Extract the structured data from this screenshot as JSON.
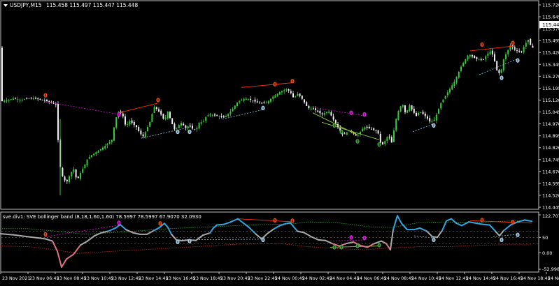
{
  "main_panel": {
    "symbol_label": "USDJPY,M15",
    "ohlc_label": "115.458 115.497 115.447 115.448",
    "current_price_label": "115.448",
    "price_ticks": [
      "115.720",
      "115.645",
      "115.570",
      "115.495",
      "115.420",
      "115.345",
      "115.270",
      "115.195",
      "115.120",
      "115.045",
      "114.970",
      "114.895",
      "114.820",
      "114.745",
      "114.670",
      "114.595",
      "114.520",
      "114.445"
    ],
    "ylim": [
      114.445,
      115.72
    ]
  },
  "sub_panel": {
    "indicator_label": "sve.div1: SVE bollinger band (8,18,1.60,1.60) 78.5997 78.5997 67.9070 32.0930",
    "level_ticks": [
      "122.7079",
      "50",
      "0.00",
      "-52.9981"
    ],
    "ylim": [
      -52.9981,
      122.7079
    ]
  },
  "time_axis": {
    "labels": [
      "23 Nov 2021",
      "23 Nov 06:45",
      "23 Nov 08:45",
      "23 Nov 10:45",
      "23 Nov 12:45",
      "23 Nov 14:45",
      "23 Nov 16:45",
      "23 Nov 18:45",
      "23 Nov 20:45",
      "23 Nov 22:45",
      "24 Nov 00:45",
      "24 Nov 02:45",
      "24 Nov 04:45",
      "24 Nov 06:45",
      "24 Nov 08:45",
      "24 Nov 10:45",
      "24 Nov 12:45",
      "24 Nov 14:45",
      "24 Nov 16:45",
      "24 Nov 18:45",
      "24 Nov 20:45"
    ]
  },
  "colors": {
    "background": "#000000",
    "axis_text": "#ffffff",
    "candle_bull": "#32cd32",
    "candle_bear": "#f0f0f0",
    "divergence_bear_line": "#ff3300",
    "divergence_bull_line": "#7fb3d5",
    "hidden_bear_line": "#d000d0",
    "hidden_bull_line": "#9acd32",
    "indicator_grey": "#a9a9a9",
    "indicator_blue": "#2ea8e0",
    "indicator_pink": "#e0708a",
    "band_upper": "#2ea82e",
    "band_lower": "#cc2020",
    "marker_red": "#e8481a",
    "marker_blue": "#a8d0ea",
    "marker_magenta": "#e020e0",
    "marker_green": "#40a040"
  },
  "chart_data": {
    "type": "line",
    "price_line": [
      [
        0,
        115.11
      ],
      [
        10,
        115.12
      ],
      [
        20,
        115.13
      ],
      [
        30,
        115.12
      ],
      [
        40,
        115.13
      ],
      [
        50,
        115.13
      ],
      [
        60,
        115.12
      ],
      [
        70,
        115.11
      ],
      [
        80,
        115.09
      ],
      [
        85,
        114.72
      ],
      [
        90,
        114.63
      ],
      [
        95,
        114.6
      ],
      [
        100,
        114.65
      ],
      [
        105,
        114.69
      ],
      [
        110,
        114.61
      ],
      [
        115,
        114.66
      ],
      [
        120,
        114.7
      ],
      [
        125,
        114.75
      ],
      [
        130,
        114.77
      ],
      [
        140,
        114.8
      ],
      [
        150,
        114.83
      ],
      [
        160,
        114.87
      ],
      [
        165,
        115.0
      ],
      [
        170,
        115.05
      ],
      [
        175,
        115.03
      ],
      [
        180,
        114.95
      ],
      [
        185,
        114.99
      ],
      [
        190,
        114.97
      ],
      [
        195,
        114.95
      ],
      [
        200,
        114.91
      ],
      [
        205,
        114.89
      ],
      [
        210,
        114.94
      ],
      [
        215,
        114.99
      ],
      [
        220,
        115.08
      ],
      [
        225,
        115.06
      ],
      [
        230,
        115.03
      ],
      [
        235,
        114.99
      ],
      [
        240,
        115.05
      ],
      [
        245,
        114.98
      ],
      [
        250,
        114.93
      ],
      [
        255,
        114.96
      ],
      [
        260,
        114.98
      ],
      [
        265,
        114.94
      ],
      [
        270,
        114.96
      ],
      [
        275,
        114.94
      ],
      [
        280,
        114.93
      ],
      [
        285,
        114.98
      ],
      [
        290,
        114.98
      ],
      [
        295,
        115.02
      ],
      [
        300,
        115.03
      ],
      [
        310,
        115.02
      ],
      [
        320,
        115.01
      ],
      [
        330,
        115.05
      ],
      [
        340,
        115.11
      ],
      [
        350,
        115.13
      ],
      [
        360,
        115.12
      ],
      [
        370,
        115.1
      ],
      [
        380,
        115.1
      ],
      [
        390,
        115.14
      ],
      [
        400,
        115.17
      ],
      [
        410,
        115.19
      ],
      [
        415,
        115.17
      ],
      [
        420,
        115.13
      ],
      [
        425,
        115.16
      ],
      [
        430,
        115.14
      ],
      [
        440,
        115.07
      ],
      [
        450,
        115.06
      ],
      [
        460,
        115.03
      ],
      [
        470,
        115.05
      ],
      [
        480,
        114.97
      ],
      [
        490,
        114.9
      ],
      [
        500,
        114.93
      ],
      [
        510,
        114.89
      ],
      [
        520,
        114.95
      ],
      [
        530,
        114.94
      ],
      [
        540,
        114.92
      ],
      [
        545,
        114.83
      ],
      [
        550,
        114.86
      ],
      [
        555,
        114.9
      ],
      [
        560,
        114.85
      ],
      [
        565,
        114.98
      ],
      [
        570,
        115.06
      ],
      [
        575,
        115.1
      ],
      [
        580,
        115.03
      ],
      [
        585,
        115.09
      ],
      [
        590,
        115.05
      ],
      [
        595,
        115.02
      ],
      [
        600,
        115.05
      ],
      [
        605,
        115.03
      ],
      [
        610,
        115.01
      ],
      [
        615,
        114.98
      ],
      [
        620,
        114.99
      ],
      [
        625,
        115.04
      ],
      [
        630,
        115.1
      ],
      [
        640,
        115.17
      ],
      [
        650,
        115.24
      ],
      [
        660,
        115.34
      ],
      [
        670,
        115.41
      ],
      [
        680,
        115.38
      ],
      [
        690,
        115.37
      ],
      [
        700,
        115.43
      ],
      [
        705,
        115.4
      ],
      [
        710,
        115.31
      ],
      [
        715,
        115.28
      ],
      [
        720,
        115.38
      ],
      [
        730,
        115.47
      ],
      [
        735,
        115.44
      ],
      [
        740,
        115.43
      ],
      [
        745,
        115.42
      ],
      [
        750,
        115.47
      ],
      [
        755,
        115.5
      ],
      [
        760,
        115.45
      ]
    ],
    "indicator_line": [
      [
        0,
        62
      ],
      [
        20,
        58
      ],
      [
        40,
        52
      ],
      [
        55,
        48
      ],
      [
        65,
        45
      ],
      [
        75,
        38
      ],
      [
        82,
        5
      ],
      [
        88,
        -46
      ],
      [
        95,
        -20
      ],
      [
        105,
        -5
      ],
      [
        115,
        25
      ],
      [
        125,
        38
      ],
      [
        135,
        55
      ],
      [
        145,
        65
      ],
      [
        155,
        70
      ],
      [
        165,
        80
      ],
      [
        172,
        91
      ],
      [
        180,
        75
      ],
      [
        190,
        65
      ],
      [
        200,
        60
      ],
      [
        210,
        60
      ],
      [
        220,
        72
      ],
      [
        228,
        82
      ],
      [
        235,
        95
      ],
      [
        240,
        82
      ],
      [
        245,
        60
      ],
      [
        252,
        42
      ],
      [
        260,
        39
      ],
      [
        270,
        42
      ],
      [
        280,
        40
      ],
      [
        290,
        57
      ],
      [
        300,
        64
      ],
      [
        305,
        80
      ],
      [
        310,
        90
      ],
      [
        320,
        92
      ],
      [
        330,
        100
      ],
      [
        340,
        110
      ],
      [
        348,
        96
      ],
      [
        356,
        82
      ],
      [
        366,
        60
      ],
      [
        374,
        45
      ],
      [
        382,
        62
      ],
      [
        392,
        78
      ],
      [
        400,
        88
      ],
      [
        408,
        94
      ],
      [
        415,
        97
      ],
      [
        425,
        70
      ],
      [
        435,
        65
      ],
      [
        445,
        52
      ],
      [
        455,
        42
      ],
      [
        465,
        40
      ],
      [
        475,
        30
      ],
      [
        485,
        22
      ],
      [
        495,
        30
      ],
      [
        505,
        35
      ],
      [
        515,
        24
      ],
      [
        525,
        18
      ],
      [
        535,
        30
      ],
      [
        545,
        38
      ],
      [
        552,
        30
      ],
      [
        558,
        10
      ],
      [
        562,
        75
      ],
      [
        568,
        120
      ],
      [
        574,
        95
      ],
      [
        582,
        75
      ],
      [
        592,
        75
      ],
      [
        600,
        80
      ],
      [
        610,
        70
      ],
      [
        618,
        52
      ],
      [
        625,
        50
      ],
      [
        632,
        72
      ],
      [
        638,
        103
      ],
      [
        645,
        110
      ],
      [
        652,
        96
      ],
      [
        660,
        88
      ],
      [
        670,
        100
      ],
      [
        680,
        96
      ],
      [
        690,
        92
      ],
      [
        700,
        90
      ],
      [
        708,
        70
      ],
      [
        714,
        55
      ],
      [
        720,
        72
      ],
      [
        730,
        90
      ],
      [
        740,
        100
      ],
      [
        750,
        106
      ],
      [
        760,
        102
      ]
    ],
    "upper_band": [
      [
        0,
        78
      ],
      [
        40,
        78
      ],
      [
        80,
        70
      ],
      [
        120,
        60
      ],
      [
        180,
        68
      ],
      [
        240,
        78
      ],
      [
        300,
        84
      ],
      [
        360,
        90
      ],
      [
        420,
        94
      ],
      [
        440,
        100
      ],
      [
        480,
        98
      ],
      [
        530,
        84
      ],
      [
        560,
        82
      ],
      [
        600,
        98
      ],
      [
        640,
        100
      ],
      [
        680,
        98
      ],
      [
        720,
        102
      ],
      [
        760,
        104
      ]
    ],
    "lower_band": [
      [
        0,
        22
      ],
      [
        40,
        20
      ],
      [
        80,
        10
      ],
      [
        110,
        -2
      ],
      [
        160,
        5
      ],
      [
        220,
        12
      ],
      [
        280,
        20
      ],
      [
        340,
        28
      ],
      [
        400,
        30
      ],
      [
        440,
        20
      ],
      [
        480,
        14
      ],
      [
        520,
        10
      ],
      [
        560,
        16
      ],
      [
        600,
        20
      ],
      [
        640,
        20
      ],
      [
        680,
        24
      ],
      [
        720,
        26
      ],
      [
        760,
        26
      ]
    ],
    "upper_level": 70,
    "mid_level": 50,
    "lower_level": 30,
    "divergence_lines": [
      {
        "panel": "main",
        "kind": "bear",
        "from": [
          170,
          115.04
        ],
        "to": [
          225,
          115.1
        ]
      },
      {
        "panel": "main",
        "kind": "bear",
        "from": [
          345,
          115.2
        ],
        "to": [
          420,
          115.23
        ]
      },
      {
        "panel": "main",
        "kind": "bear",
        "from": [
          672,
          115.43
        ],
        "to": [
          733,
          115.46
        ]
      },
      {
        "panel": "main",
        "kind": "hidden_bear",
        "from": [
          65,
          115.11
        ],
        "to": [
          170,
          115.03
        ]
      },
      {
        "panel": "main",
        "kind": "hidden_bear",
        "from": [
          453,
          115.07
        ],
        "to": [
          522,
          115.02
        ]
      },
      {
        "panel": "main",
        "kind": "bull",
        "from": [
          202,
          114.88
        ],
        "to": [
          272,
          114.95
        ]
      },
      {
        "panel": "main",
        "kind": "bull",
        "from": [
          318,
          115.0
        ],
        "to": [
          376,
          115.06
        ]
      },
      {
        "panel": "main",
        "kind": "bull",
        "from": [
          590,
          114.92
        ],
        "to": [
          620,
          114.97
        ]
      },
      {
        "panel": "main",
        "kind": "bull",
        "from": [
          685,
          115.28
        ],
        "to": [
          740,
          115.38
        ]
      },
      {
        "panel": "main",
        "kind": "hidden_bull",
        "from": [
          447,
          115.04
        ],
        "to": [
          511,
          114.9
        ]
      },
      {
        "panel": "main",
        "kind": "hidden_bull",
        "from": [
          460,
          114.98
        ],
        "to": [
          542,
          114.87
        ]
      },
      {
        "panel": "sub",
        "kind": "bear",
        "from": [
          340,
          110
        ],
        "to": [
          420,
          100
        ]
      },
      {
        "panel": "sub",
        "kind": "bear",
        "from": [
          672,
          104
        ],
        "to": [
          760,
          96
        ]
      },
      {
        "panel": "sub",
        "kind": "hidden_bear",
        "from": [
          65,
          52
        ],
        "to": [
          172,
          90
        ]
      },
      {
        "panel": "sub",
        "kind": "hidden_bear",
        "from": [
          472,
          38
        ],
        "to": [
          522,
          42
        ]
      },
      {
        "panel": "sub",
        "kind": "bull",
        "from": [
          252,
          42
        ],
        "to": [
          376,
          44
        ]
      },
      {
        "panel": "sub",
        "kind": "bull",
        "from": [
          592,
          55
        ],
        "to": [
          620,
          48
        ]
      },
      {
        "panel": "sub",
        "kind": "bull",
        "from": [
          705,
          52
        ],
        "to": [
          740,
          60
        ]
      },
      {
        "panel": "sub",
        "kind": "hidden_bull",
        "from": [
          472,
          18
        ],
        "to": [
          542,
          22
        ]
      }
    ],
    "markers": [
      {
        "panel": "main",
        "kind": "red",
        "x": 65,
        "y": 115.15
      },
      {
        "panel": "main",
        "kind": "red",
        "x": 226,
        "y": 115.12
      },
      {
        "panel": "main",
        "kind": "red",
        "x": 393,
        "y": 115.22
      },
      {
        "panel": "main",
        "kind": "red",
        "x": 418,
        "y": 115.24
      },
      {
        "panel": "main",
        "kind": "red",
        "x": 689,
        "y": 115.47
      },
      {
        "panel": "main",
        "kind": "red",
        "x": 733,
        "y": 115.48
      },
      {
        "panel": "main",
        "kind": "magenta",
        "x": 170,
        "y": 115.03
      },
      {
        "panel": "main",
        "kind": "magenta",
        "x": 502,
        "y": 115.04
      },
      {
        "panel": "main",
        "kind": "magenta",
        "x": 521,
        "y": 115.03
      },
      {
        "panel": "main",
        "kind": "blue",
        "x": 254,
        "y": 114.92
      },
      {
        "panel": "main",
        "kind": "blue",
        "x": 271,
        "y": 114.92
      },
      {
        "panel": "main",
        "kind": "blue",
        "x": 376,
        "y": 115.07
      },
      {
        "panel": "main",
        "kind": "blue",
        "x": 620,
        "y": 114.96
      },
      {
        "panel": "main",
        "kind": "blue",
        "x": 717,
        "y": 115.26
      },
      {
        "panel": "main",
        "kind": "blue",
        "x": 740,
        "y": 115.37
      },
      {
        "panel": "main",
        "kind": "green",
        "x": 478,
        "y": 114.96
      },
      {
        "panel": "main",
        "kind": "green",
        "x": 488,
        "y": 114.92
      },
      {
        "panel": "main",
        "kind": "green",
        "x": 511,
        "y": 114.86
      },
      {
        "panel": "main",
        "kind": "green",
        "x": 542,
        "y": 114.84
      },
      {
        "panel": "sub",
        "kind": "red",
        "x": 65,
        "y": 60
      },
      {
        "panel": "sub",
        "kind": "red",
        "x": 229,
        "y": 95
      },
      {
        "panel": "sub",
        "kind": "red",
        "x": 393,
        "y": 105
      },
      {
        "panel": "sub",
        "kind": "red",
        "x": 418,
        "y": 104
      },
      {
        "panel": "sub",
        "kind": "red",
        "x": 689,
        "y": 106
      },
      {
        "panel": "sub",
        "kind": "red",
        "x": 733,
        "y": 100
      },
      {
        "panel": "sub",
        "kind": "magenta",
        "x": 170,
        "y": 97
      },
      {
        "panel": "sub",
        "kind": "magenta",
        "x": 502,
        "y": 50
      },
      {
        "panel": "sub",
        "kind": "magenta",
        "x": 521,
        "y": 48
      },
      {
        "panel": "sub",
        "kind": "blue",
        "x": 254,
        "y": 35
      },
      {
        "panel": "sub",
        "kind": "blue",
        "x": 271,
        "y": 38
      },
      {
        "panel": "sub",
        "kind": "blue",
        "x": 376,
        "y": 42
      },
      {
        "panel": "sub",
        "kind": "blue",
        "x": 620,
        "y": 42
      },
      {
        "panel": "sub",
        "kind": "blue",
        "x": 717,
        "y": 42
      },
      {
        "panel": "sub",
        "kind": "blue",
        "x": 740,
        "y": 58
      },
      {
        "panel": "sub",
        "kind": "green",
        "x": 478,
        "y": 18
      },
      {
        "panel": "sub",
        "kind": "green",
        "x": 488,
        "y": 18
      },
      {
        "panel": "sub",
        "kind": "green",
        "x": 511,
        "y": 22
      },
      {
        "panel": "sub",
        "kind": "green",
        "x": 542,
        "y": 25
      }
    ]
  }
}
